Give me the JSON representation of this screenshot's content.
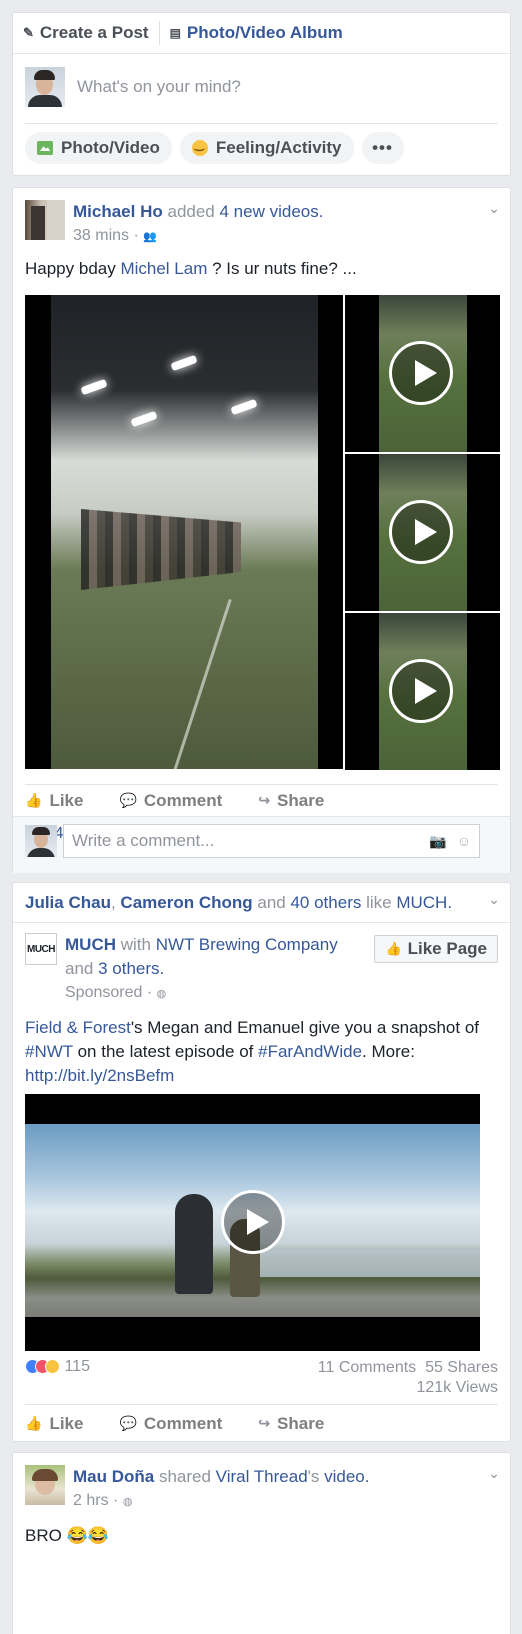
{
  "composer": {
    "tab_create": "Create a Post",
    "tab_album": "Photo/Video Album",
    "placeholder": "What's on your mind?",
    "btn_photo": "Photo/Video",
    "btn_feeling": "Feeling/Activity",
    "btn_more": "•••"
  },
  "post1": {
    "author": "Michael Ho",
    "action": "added",
    "action_link": "4 new videos.",
    "time": "38 mins",
    "text_before": "Happy bday ",
    "mention": "Michel Lam",
    "text_after": " ? Is ur nuts fine? ...",
    "like": "Like",
    "comment": "Comment",
    "share": "Share",
    "reaction_count": "4",
    "comment_placeholder": "Write a comment..."
  },
  "post2": {
    "friend1": "Julia Chau",
    "sep": ", ",
    "friend2": "Cameron Chong",
    "and": " and ",
    "others": "40 others",
    "like_word": " like ",
    "page": "MUCH.",
    "logo_text": "MUCH",
    "page_name": "MUCH",
    "with": " with ",
    "with_page": "NWT Brewing Company",
    "and2": " and ",
    "others2": "3 others.",
    "sponsored": "Sponsored",
    "like_page": "Like Page",
    "text_link1": "Field & Forest",
    "text_1": "'s Megan and Emanuel give you a snapshot of ",
    "hashtag1": "#NWT",
    "text_2": " on the latest episode of ",
    "hashtag2": "#FarAndWide",
    "text_3": ". More: ",
    "url": "http://bit.ly/2nsBefm",
    "reaction_count": "115",
    "comments": "11 Comments",
    "shares": "55 Shares",
    "views": "121k Views",
    "like": "Like",
    "comment": "Comment",
    "share": "Share"
  },
  "post3": {
    "author": "Mau Doña",
    "action": " shared ",
    "source": "Viral Thread",
    "action_end": "'s ",
    "video": "video.",
    "time": "2 hrs",
    "text": "BRO 😂😂"
  }
}
